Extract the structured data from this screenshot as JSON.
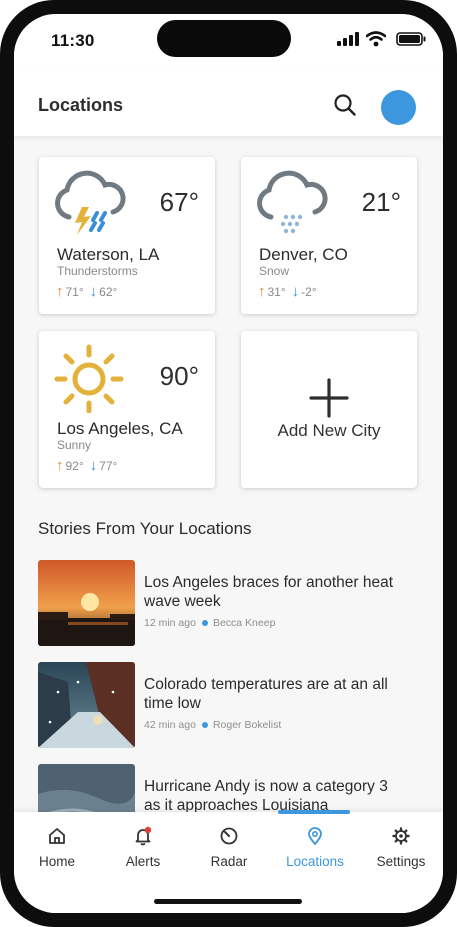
{
  "status_bar": {
    "time": "11:30"
  },
  "header": {
    "title": "Locations"
  },
  "locations": [
    {
      "city": "Waterson, LA",
      "temp": "67°",
      "condition": "Thunderstorms",
      "high": "71°",
      "low": "62°",
      "icon": "thunderstorm-icon"
    },
    {
      "city": "Denver, CO",
      "temp": "21°",
      "condition": "Snow",
      "high": "31°",
      "low": "-2°",
      "icon": "snow-icon"
    },
    {
      "city": "Los Angeles, CA",
      "temp": "90°",
      "condition": "Sunny",
      "high": "92°",
      "low": "77°",
      "icon": "sun-icon"
    }
  ],
  "add_city": {
    "label": "Add New City"
  },
  "stories": {
    "title": "Stories From Your Locations",
    "items": [
      {
        "headline": "Los Angeles braces for another heat wave week",
        "time": "12 min ago",
        "author": "Becca Kneep"
      },
      {
        "headline": "Colorado temperatures are at an all time low",
        "time": "42 min ago",
        "author": "Roger Bokelist"
      },
      {
        "headline": "Hurricane Andy is now a category 3 as it approaches Louisiana",
        "time": "",
        "author": ""
      }
    ]
  },
  "nav": {
    "items": [
      {
        "label": "Home",
        "icon": "home-icon"
      },
      {
        "label": "Alerts",
        "icon": "bell-icon"
      },
      {
        "label": "Radar",
        "icon": "radar-icon"
      },
      {
        "label": "Locations",
        "icon": "location-pin-icon"
      },
      {
        "label": "Settings",
        "icon": "gear-icon"
      }
    ],
    "active": "Locations"
  },
  "colors": {
    "accent": "#3c97de",
    "up_arrow": "#d98b2b",
    "down_arrow": "#3a8fd6",
    "sun": "#e2b23a",
    "cloud": "#6f7a83"
  }
}
